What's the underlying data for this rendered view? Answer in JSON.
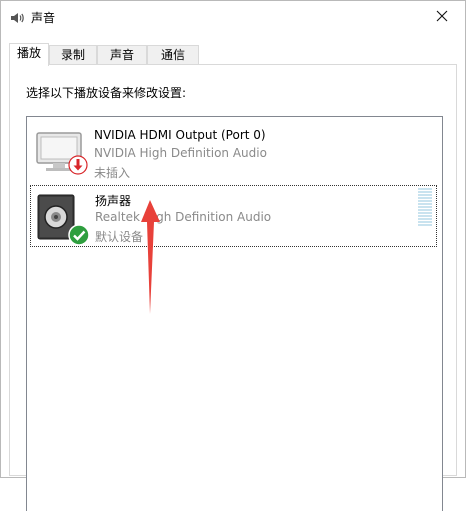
{
  "window": {
    "title": "声音"
  },
  "tabs": [
    {
      "label": "播放",
      "active": true
    },
    {
      "label": "录制",
      "active": false
    },
    {
      "label": "声音",
      "active": false
    },
    {
      "label": "通信",
      "active": false
    }
  ],
  "panel": {
    "instruction": "选择以下播放设备来修改设置:"
  },
  "devices": [
    {
      "name": "NVIDIA HDMI Output (Port 0)",
      "description": "NVIDIA High Definition Audio",
      "status": "未插入",
      "icon": "monitor-icon",
      "badge": "unplugged-badge"
    },
    {
      "name": "扬声器",
      "description": "Realtek High Definition Audio",
      "status": "默认设备",
      "icon": "speaker-icon",
      "badge": "default-check-badge"
    }
  ],
  "colors": {
    "annotation_arrow": "#e8413a",
    "default_badge": "#2e9e3e",
    "unplugged_badge": "#d8262a"
  }
}
